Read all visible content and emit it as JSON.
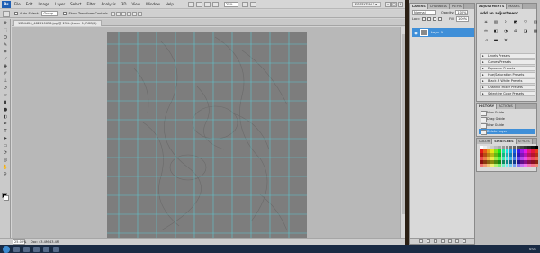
{
  "app": {
    "logo": "Ps",
    "menu": [
      "File",
      "Edit",
      "Image",
      "Layer",
      "Select",
      "Filter",
      "Analysis",
      "3D",
      "View",
      "Window",
      "Help"
    ],
    "zoom": "25%",
    "workspace": "ESSENTIALS ▾"
  },
  "options": {
    "auto_select_label": "Auto-Select:",
    "auto_select_value": "Group",
    "transform_label": "Show Transform Controls"
  },
  "document": {
    "tab_title": "1254426_482610658.jpg @ 25% (Layer 1, RGB/8)",
    "status_zoom": "25.03%",
    "status_doc": "Doc: 43.4M/43.4M"
  },
  "layers_panel": {
    "tabs": [
      "LAYERS",
      "CHANNELS",
      "PATHS"
    ],
    "blend_mode": "Normal",
    "opacity_label": "Opacity:",
    "opacity_value": "100%",
    "lock_label": "Lock:",
    "fill_label": "Fill:",
    "fill_value": "100%",
    "layer_name": "Layer 1"
  },
  "adjustments": {
    "tabs": [
      "ADJUSTMENTS",
      "MASKS"
    ],
    "title": "Add an adjustment",
    "presets": [
      "Levels Presets",
      "Curves Presets",
      "Exposure Presets",
      "Hue/Saturation Presets",
      "Black & White Presets",
      "Channel Mixer Presets",
      "Selective Color Presets"
    ]
  },
  "history": {
    "tabs": [
      "HISTORY",
      "ACTIONS"
    ],
    "items": [
      "New Guide",
      "Drag Guide",
      "New Guide",
      "Delete Layer"
    ]
  },
  "swatches_panel": {
    "tabs": [
      "COLOR",
      "SWATCHES",
      "STYLES"
    ]
  },
  "taskbar": {
    "clock": "0:01"
  }
}
